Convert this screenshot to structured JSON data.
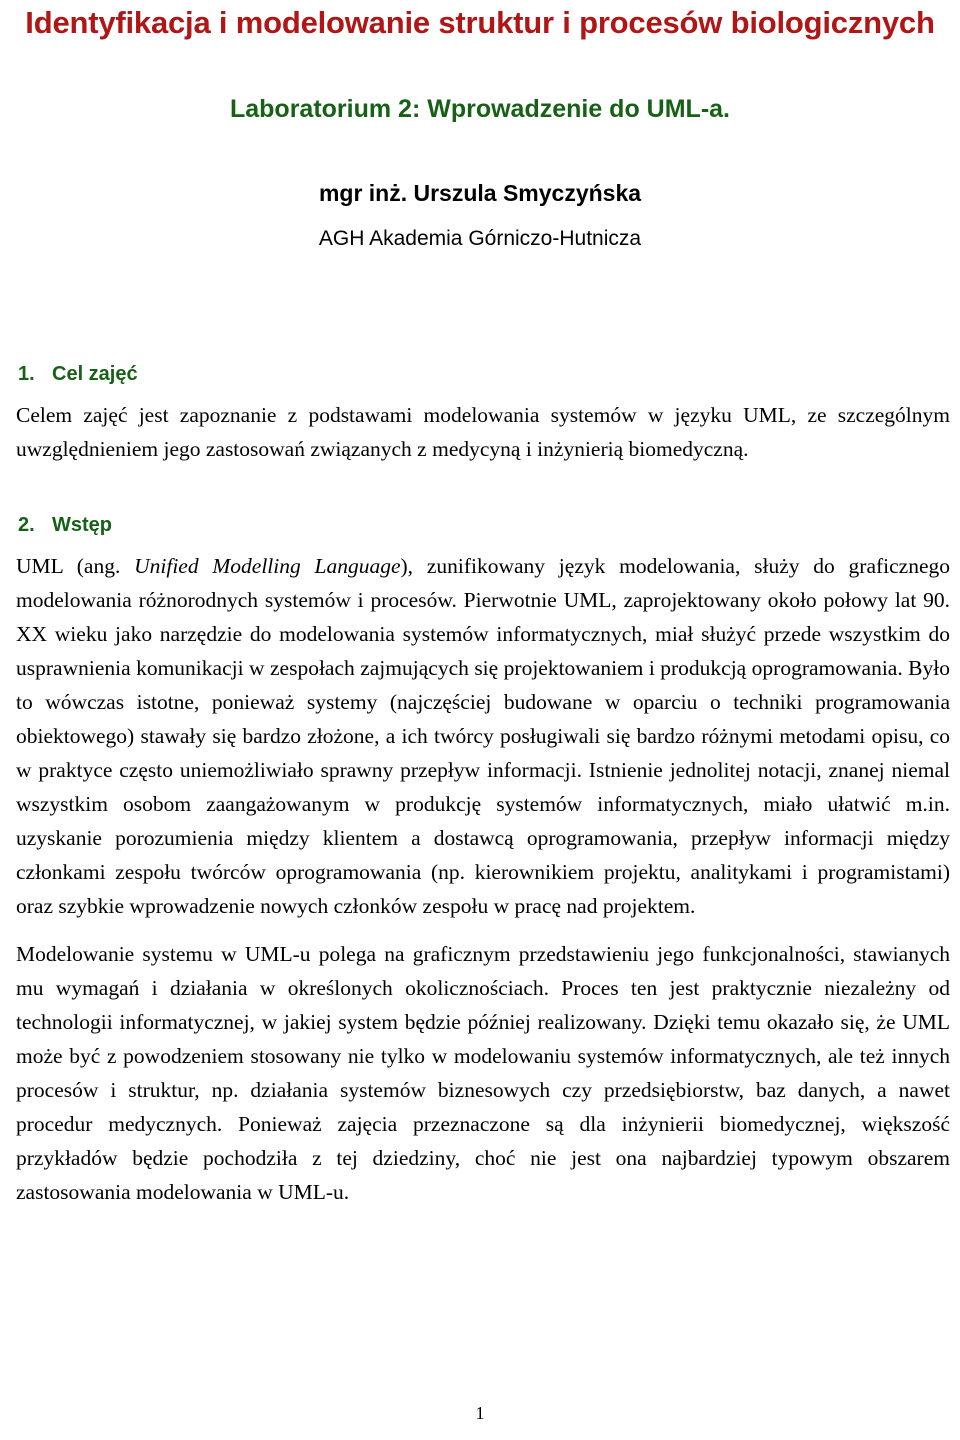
{
  "colors": {
    "title_red": "#B01616",
    "heading_green": "#176117",
    "body_black": "#000000",
    "page_background": "#FFFFFF"
  },
  "title_block": {
    "title": "Identyfikacja i modelowanie struktur i procesów biologicznych",
    "subtitle": "Laboratorium 2: Wprowadzenie do UML-a.",
    "author": "mgr inż. Urszula Smyczyńska",
    "affiliation": "AGH Akademia Górniczo-Hutnicza"
  },
  "sections": [
    {
      "number": "1.",
      "heading": "Cel zajęć",
      "paragraphs": [
        "Celem zajęć jest zapoznanie z podstawami modelowania systemów w języku UML, ze szczególnym uwzględnieniem jego zastosowań związanych z medycyną i inżynierią biomedyczną."
      ]
    },
    {
      "number": "2.",
      "heading": "Wstęp",
      "paragraphs": [
        "UML (ang. Unified Modelling Language), zunifikowany język modelowania, służy do graficznego modelowania różnorodnych systemów i procesów. Pierwotnie UML, zaprojektowany około połowy lat 90. XX wieku jako narzędzie do modelowania systemów informatycznych, miał służyć przede wszystkim do usprawnienia komunikacji w zespołach zajmujących się projektowaniem i produkcją oprogramowania. Było to wówczas istotne, ponieważ systemy (najczęściej budowane w oparciu o techniki programowania obiektowego) stawały się bardzo złożone, a ich twórcy posługiwali się bardzo różnymi metodami opisu, co w praktyce często uniemożliwiało sprawny przepływ informacji. Istnienie jednolitej notacji, znanej niemal wszystkim osobom zaangażowanym w produkcję systemów informatycznych, miało ułatwić m.in. uzyskanie porozumienia między klientem a dostawcą oprogramowania, przepływ informacji między członkami zespołu twórców oprogramowania (np. kierownikiem projektu, analitykami i programistami) oraz szybkie wprowadzenie nowych członków zespołu w pracę nad projektem.",
        "Modelowanie systemu w UML-u polega na graficznym przedstawieniu jego funkcjonalności, stawianych mu wymagań i działania w określonych okolicznościach. Proces ten jest praktycznie niezależny od technologii informatycznej, w jakiej system będzie później realizowany. Dzięki temu okazało się, że UML może być z powodzeniem stosowany nie tylko w modelowaniu systemów informatycznych, ale też innych procesów i struktur, np. działania systemów biznesowych czy przedsiębiorstw, baz danych, a nawet procedur medycznych. Ponieważ zajęcia przeznaczone są dla inżynierii biomedycznej, większość przykładów będzie pochodziła z tej dziedziny, choć nie jest ona najbardziej typowym obszarem zastosowania modelowania w UML-u."
      ],
      "paragraph_1_parts": {
        "before_italic": "UML (ang. ",
        "italic": "Unified Modelling Language",
        "after_italic": "), zunifikowany język modelowania, służy do graficznego modelowania różnorodnych systemów i procesów. Pierwotnie UML, zaprojektowany około połowy lat 90. XX wieku jako narzędzie do modelowania systemów informatycznych, miał służyć przede wszystkim do usprawnienia komunikacji w zespołach zajmujących się projektowaniem i produkcją oprogramowania. Było to wówczas istotne, ponieważ systemy (najczęściej budowane w oparciu o techniki programowania obiektowego) stawały się bardzo złożone, a ich twórcy posługiwali się bardzo różnymi metodami opisu, co w praktyce często uniemożliwiało sprawny przepływ informacji. Istnienie jednolitej notacji, znanej niemal wszystkim osobom zaangażowanym w produkcję systemów informatycznych, miało ułatwić m.in. uzyskanie porozumienia między klientem a dostawcą oprogramowania, przepływ informacji między członkami zespołu twórców oprogramowania (np. kierownikiem projektu, analitykami i programistami) oraz szybkie wprowadzenie nowych członków zespołu w pracę nad projektem."
      }
    }
  ],
  "footer": {
    "page_number": "1"
  }
}
